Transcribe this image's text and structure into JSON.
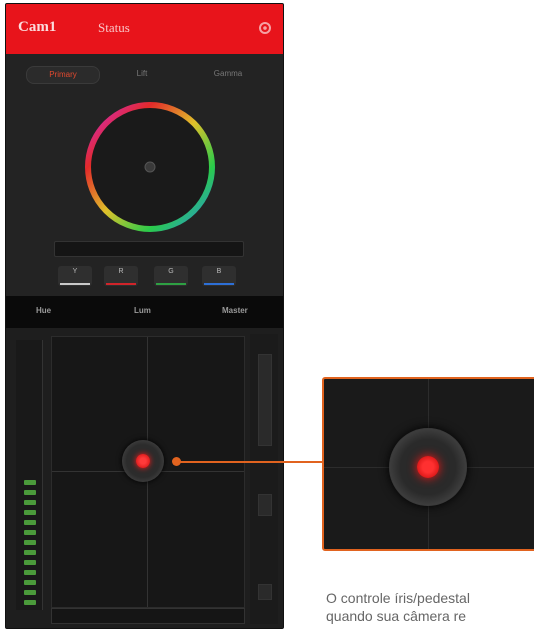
{
  "titlebar": {
    "camera": "Cam1",
    "status": "Status"
  },
  "tabs": [
    {
      "label": "Primary"
    },
    {
      "label": "Lift"
    },
    {
      "label": "Gamma"
    }
  ],
  "channels": [
    {
      "label": "Y",
      "color": "#c8c8c8"
    },
    {
      "label": "R",
      "color": "#d0242a"
    },
    {
      "label": "G",
      "color": "#2ea043"
    },
    {
      "label": "B",
      "color": "#2d6fd6"
    }
  ],
  "sub_tabs": [
    {
      "label": "Hue"
    },
    {
      "label": "Lum"
    },
    {
      "label": "Master"
    }
  ],
  "caption": {
    "line1": "O controle íris/pedestal",
    "line2": "quando sua câmera re"
  },
  "colors": {
    "accent": "#e1631f",
    "titlebar": "#e8141b",
    "tally": "#ff2a2a"
  }
}
